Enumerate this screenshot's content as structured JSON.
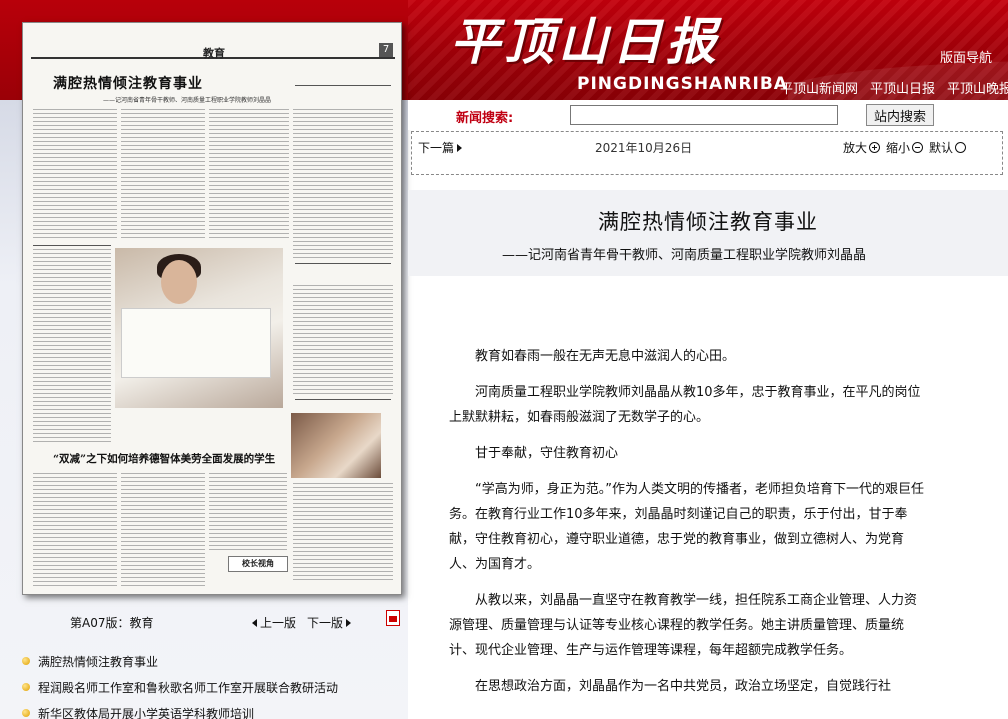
{
  "header": {
    "logo_text": "平顶山日报",
    "pinyin": "PINGDINGSHANRIBA",
    "layout_nav": "版面导航",
    "site_links": [
      "平顶山新闻网",
      "平顶山日报",
      "平顶山晚报"
    ]
  },
  "search": {
    "label": "新闻搜索:",
    "value": "",
    "button_label": "站内搜索"
  },
  "toolbar": {
    "next_article": "下一篇",
    "date": "2021年10月26日",
    "zoom_in": "放大",
    "zoom_out": "缩小",
    "zoom_default": "默认"
  },
  "newspaper_thumb": {
    "section": "教育",
    "page_no": "7",
    "headline": "满腔热情倾注教育事业",
    "subhead": "——记河南省青年骨干教师、河南质量工程职业学院教师刘晶晶",
    "headline2": "“双减”之下如何培养德智体美劳全面发展的学生",
    "badge": "校长视角"
  },
  "page_nav": {
    "page_label": "第A07版：教育",
    "prev_label": "上一版",
    "next_label": "下一版",
    "pdf_icon": "pdf-icon"
  },
  "article_list": [
    "满腔热情倾注教育事业",
    "程润殿名师工作室和鲁秋歌名师工作室开展联合教研活动",
    "新华区教体局开展小学英语学科教师培训"
  ],
  "article": {
    "title": "满腔热情倾注教育事业",
    "subtitle": "——记河南省青年骨干教师、河南质量工程职业学院教师刘晶晶",
    "paragraphs": [
      "教育如春雨一般在无声无息中滋润人的心田。",
      "河南质量工程职业学院教师刘晶晶从教10多年，忠于教育事业，在平凡的岗位上默默耕耘，如春雨般滋润了无数学子的心。",
      "甘于奉献，守住教育初心",
      "“学高为师，身正为范。”作为人类文明的传播者，老师担负培育下一代的艰巨任务。在教育行业工作10多年来，刘晶晶时刻谨记自己的职责，乐于付出，甘于奉献，守住教育初心，遵守职业道德，忠于党的教育事业，做到立德树人、为党育人、为国育才。",
      "从教以来，刘晶晶一直坚守在教育教学一线，担任院系工商企业管理、人力资源管理、质量管理与认证等专业核心课程的教学任务。她主讲质量管理、质量统计、现代企业管理、生产与运作管理等课程，每年超额完成教学任务。",
      "在思想政治方面，刘晶晶作为一名中共党员，政治立场坚定，自觉践行社"
    ]
  },
  "colors": {
    "brand_red": "#b8000a",
    "search_label_red": "#c00012"
  }
}
